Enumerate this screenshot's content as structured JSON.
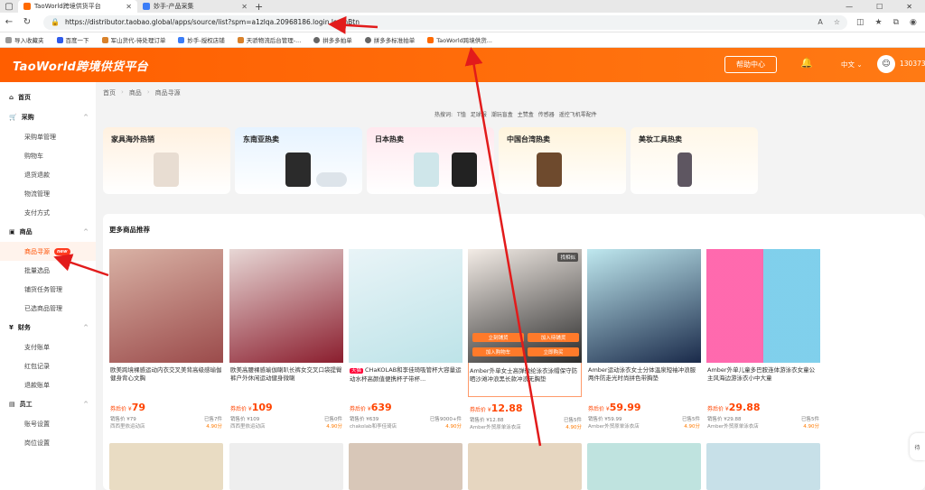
{
  "browser": {
    "tabs": [
      {
        "label": "TaoWorld跨境供货平台",
        "active": true
      },
      {
        "label": "妙手-产品采集",
        "active": false
      }
    ],
    "url": "https://distributor.taobao.global/apps/source/list?spm=a1zlqa.20968186.login.loginBtn",
    "bookmarks": [
      "导入收藏夹",
      "百度一下",
      "军山货代-待处理订单",
      "妙手-授权店铺",
      "天骄物流后台管理-...",
      "拼多多拍单",
      "拼多多标准拍单",
      "TaoWorld跨境供货..."
    ]
  },
  "header": {
    "logo": "TaoWorld跨境供货平台",
    "help_label": "帮助中心",
    "language": "中文",
    "username": "1303735"
  },
  "sidebar": {
    "sections": [
      {
        "label": "首页",
        "items": []
      },
      {
        "label": "采购",
        "items": [
          "采购单管理",
          "购物车",
          "退货退款",
          "物流管理",
          "支付方式"
        ]
      },
      {
        "label": "商品",
        "items": [
          "商品寻源",
          "批量选品",
          "铺货任务管理",
          "已选商品管理"
        ]
      },
      {
        "label": "财务",
        "items": [
          "支付账单",
          "红包记录",
          "退款账单"
        ]
      },
      {
        "label": "员工",
        "items": [
          "账号设置",
          "岗位设置"
        ]
      }
    ],
    "active_item": "商品寻源",
    "new_badge": "new"
  },
  "breadcrumb": [
    "首页",
    "商品",
    "商品寻源"
  ],
  "hotwords": [
    "热搜词:",
    "T恤",
    "足球服",
    "潮玩盲盒",
    "主赞盒",
    "传感器",
    "遥控飞机零配件"
  ],
  "categories": [
    "家具海外热销",
    "东南亚热卖",
    "日本热卖",
    "中国台湾热卖",
    "美妆工具热卖"
  ],
  "more_title": "更多商品推荐",
  "hover_buttons": {
    "add_cart": "立刻铺货",
    "add_list": "加入待铺货",
    "add_cart2": "加入购物车",
    "buy_now": "立即购买",
    "find_similar": "找相似"
  },
  "products": [
    {
      "title": "欧美跨境裸感运动内衣交叉美背高级感瑜伽健身背心文胸",
      "price": "79",
      "sold": "销售价 ¥79",
      "ship": "已售7件",
      "shop": "西西里依运动店",
      "rating": "4.90分",
      "tmall": ""
    },
    {
      "title": "欧美高腰裸感瑜伽喇叭长裤女交叉口袋提臀裤户外休闲运动健身微喇",
      "price": "109",
      "sold": "销售价 ¥109",
      "ship": "已售0件",
      "shop": "西西里依运动店",
      "rating": "4.90分",
      "tmall": ""
    },
    {
      "title": "CHaKOLAB和李佳琦吸管杯大容量运动水杯高颜值便携杯子带杯...",
      "price": "639",
      "sold": "销售价 ¥639",
      "ship": "已售9000+件",
      "shop": "chakolab和李佳琦店",
      "rating": "4.90分",
      "tmall": "天猫"
    },
    {
      "title": "Amber外单女士高弹微纶泳衣泳帽保守防晒沙滩冲浪黑长款冲浪无胸垫",
      "price": "12.88",
      "sold": "销售价 ¥12.88",
      "ship": "已售5件",
      "shop": "Amber外贸原单泳衣店",
      "rating": "4.90分",
      "tmall": ""
    },
    {
      "title": "Amber运动泳衣女士分体温泉短袖冲浪服两件防走光时尚拼色带胸垫",
      "price": "59.99",
      "sold": "销售价 ¥59.99",
      "ship": "已售5件",
      "shop": "Amber外贸原单泳衣店",
      "rating": "4.90分",
      "tmall": ""
    },
    {
      "title": "Amber外单儿童多巴胺连体游泳衣女童公主风海边游泳衣小中大童",
      "price": "29.88",
      "sold": "销售价 ¥29.88",
      "ship": "已售5件",
      "shop": "Amber外贸原单泳衣店",
      "rating": "4.90分",
      "tmall": ""
    }
  ],
  "price_prefix": "券后价 ¥",
  "floating_label": "待",
  "colors": {
    "brand": "#ff6a00",
    "price": "#ff4400",
    "arrow": "#e21b1b"
  }
}
